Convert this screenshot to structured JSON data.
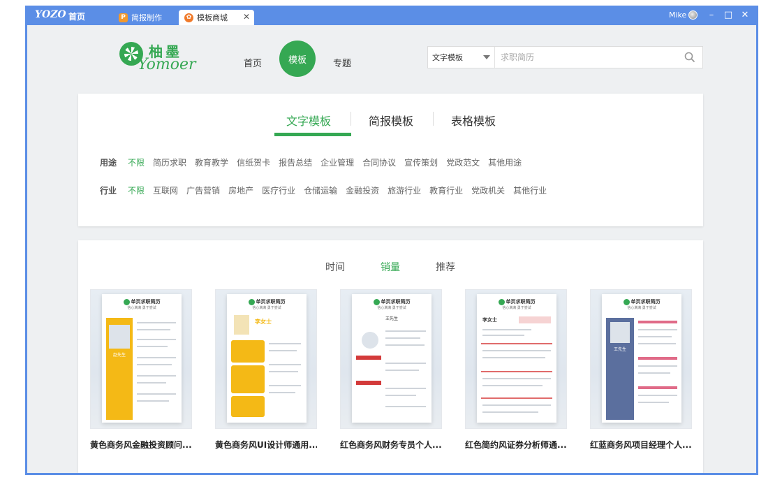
{
  "titlebar": {
    "brand": "YOZO",
    "home": "首页",
    "tabs": [
      {
        "label": "简报制作",
        "icon": "p-icon"
      },
      {
        "label": "模板商城",
        "icon": "yomoer-icon"
      }
    ],
    "user": "Mike",
    "accent": "#5b8ee6"
  },
  "header": {
    "logo_cn": "柚墨",
    "logo_en": "Yomoer",
    "nav": [
      "首页",
      "模板",
      "专题"
    ],
    "nav_active": "模板",
    "search": {
      "select_value": "文字模板",
      "placeholder": "求职简历"
    },
    "brand_color": "#35a853"
  },
  "categories": {
    "tabs": [
      "文字模板",
      "简报模板",
      "表格模板"
    ],
    "active": "文字模板"
  },
  "filters": {
    "usage": {
      "label": "用途",
      "options": [
        "不限",
        "简历求职",
        "教育教学",
        "信纸贺卡",
        "报告总结",
        "企业管理",
        "合同协议",
        "宣传策划",
        "党政范文",
        "其他用途"
      ]
    },
    "industry": {
      "label": "行业",
      "options": [
        "不限",
        "互联网",
        "广告营销",
        "房地产",
        "医疗行业",
        "仓储运输",
        "金融投资",
        "旅游行业",
        "教育行业",
        "党政机关",
        "其他行业"
      ]
    }
  },
  "sort": {
    "tabs": [
      "时间",
      "销量",
      "推荐"
    ],
    "active": "销量"
  },
  "templates": [
    {
      "title": "黄色商务风金融投资顾问...",
      "accent": "#f4b916",
      "name": "赵先生",
      "style": "yellow-sidebar"
    },
    {
      "title": "黄色商务风UI设计师通用...",
      "accent": "#f4b916",
      "name": "李女士",
      "style": "yellow-blocks"
    },
    {
      "title": "红色商务风财务专员个人...",
      "accent": "#d33a3a",
      "name": "王先生",
      "style": "red-center"
    },
    {
      "title": "红色简约风证券分析师通...",
      "accent": "#e06b6b",
      "name": "李女士",
      "style": "red-plain"
    },
    {
      "title": "红蓝商务风项目经理个人...",
      "accent": "#5b6f9e",
      "name": "王先生",
      "style": "blue-sidebar"
    }
  ],
  "resume_header": "单页求职简历",
  "resume_sub": "信心满满 勇于尝试"
}
